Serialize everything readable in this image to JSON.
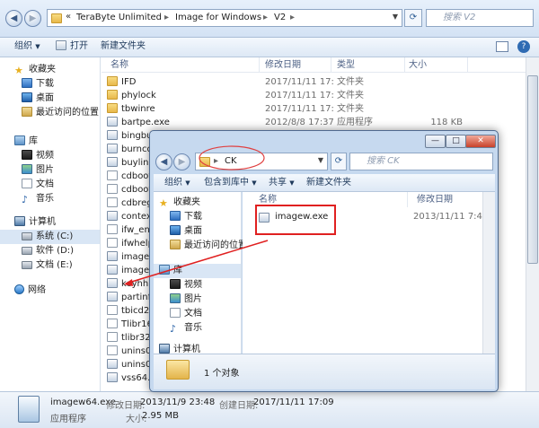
{
  "back": {
    "address": {
      "crumbs": [
        "TeraByte Unlimited",
        "Image for Windows",
        "V2"
      ],
      "prefix": "«"
    },
    "search_placeholder": "搜索 V2",
    "toolbar": {
      "organize": "组织",
      "open": "打开",
      "new_folder": "新建文件夹"
    },
    "columns": {
      "name": "名称",
      "date": "修改日期",
      "type": "类型",
      "size": "大小"
    },
    "nav": {
      "favorites": "收藏夹",
      "downloads": "下载",
      "desktop": "桌面",
      "recent": "最近访问的位置",
      "libraries": "库",
      "videos": "视频",
      "pictures": "图片",
      "documents": "文档",
      "music": "音乐",
      "computer": "计算机",
      "drive_c": "系统 (C:)",
      "drive_d": "软件 (D:)",
      "drive_e": "文档 (E:)",
      "network": "网络"
    },
    "files": [
      {
        "name": "IFD",
        "date": "2017/11/11 17:10",
        "type": "文件夹",
        "size": "",
        "icon": "folder"
      },
      {
        "name": "phylock",
        "date": "2017/11/11 17:10",
        "type": "文件夹",
        "size": "",
        "icon": "folder"
      },
      {
        "name": "tbwinre",
        "date": "2017/11/11 17:10",
        "type": "文件夹",
        "size": "",
        "icon": "folder"
      },
      {
        "name": "bartpe.exe",
        "date": "2012/8/8 17:37",
        "type": "应用程序",
        "size": "118 KB",
        "icon": "exe"
      },
      {
        "name": "bingbu",
        "date": "",
        "type": "",
        "size": "",
        "icon": "exe"
      },
      {
        "name": "burncd",
        "date": "",
        "type": "",
        "size": "",
        "icon": "exe"
      },
      {
        "name": "buylink",
        "date": "",
        "type": "",
        "size": "",
        "icon": "exe"
      },
      {
        "name": "cdboot",
        "date": "",
        "type": "",
        "size": "",
        "icon": "doc"
      },
      {
        "name": "cdboot",
        "date": "",
        "type": "",
        "size": "",
        "icon": "doc"
      },
      {
        "name": "cdbreg",
        "date": "",
        "type": "",
        "size": "",
        "icon": "doc"
      },
      {
        "name": "context",
        "date": "",
        "type": "",
        "size": "",
        "icon": "exe"
      },
      {
        "name": "ifw_en_",
        "date": "",
        "type": "",
        "size": "",
        "icon": "doc"
      },
      {
        "name": "ifwhelp",
        "date": "",
        "type": "",
        "size": "",
        "icon": "doc"
      },
      {
        "name": "imagew",
        "date": "",
        "type": "",
        "size": "",
        "icon": "exe"
      },
      {
        "name": "imagew",
        "date": "",
        "type": "",
        "size": "",
        "icon": "exe"
      },
      {
        "name": "keyhh.",
        "date": "",
        "type": "",
        "size": "",
        "icon": "exe"
      },
      {
        "name": "partinfg",
        "date": "",
        "type": "",
        "size": "",
        "icon": "exe"
      },
      {
        "name": "tbicd2h",
        "date": "",
        "type": "",
        "size": "",
        "icon": "doc"
      },
      {
        "name": "Tlibr16.",
        "date": "",
        "type": "",
        "size": "",
        "icon": "doc"
      },
      {
        "name": "tlibr32.",
        "date": "",
        "type": "",
        "size": "",
        "icon": "doc"
      },
      {
        "name": "unins00",
        "date": "",
        "type": "",
        "size": "",
        "icon": "doc"
      },
      {
        "name": "unins00",
        "date": "",
        "type": "",
        "size": "",
        "icon": "exe"
      },
      {
        "name": "vss64.e",
        "date": "",
        "type": "",
        "size": "",
        "icon": "exe"
      }
    ],
    "status": {
      "name": "imagew64.exe",
      "modified_label": "修改日期:",
      "modified": "2013/11/9 23:48",
      "created_label": "创建日期:",
      "created": "2017/11/11 17:09",
      "type": "应用程序",
      "size_label": "大小:",
      "size": "2.95 MB"
    }
  },
  "front": {
    "address": {
      "folder": "CK"
    },
    "search_placeholder": "搜索 CK",
    "toolbar": {
      "organize": "组织",
      "include": "包含到库中",
      "share": "共享",
      "new_folder": "新建文件夹"
    },
    "columns": {
      "name": "名称",
      "date": "修改日期"
    },
    "nav": {
      "favorites": "收藏夹",
      "downloads": "下载",
      "desktop": "桌面",
      "recent": "最近访问的位置",
      "libraries": "库",
      "videos": "视频",
      "pictures": "图片",
      "documents": "文档",
      "music": "音乐",
      "computer": "计算机"
    },
    "file": {
      "name": "imagew.exe",
      "date": "2013/11/11 7:42"
    },
    "status": "1 个对象"
  },
  "colors": {
    "highlight_box": "#e02020",
    "arrow": "#e02020",
    "ellipse": "#e04040"
  }
}
